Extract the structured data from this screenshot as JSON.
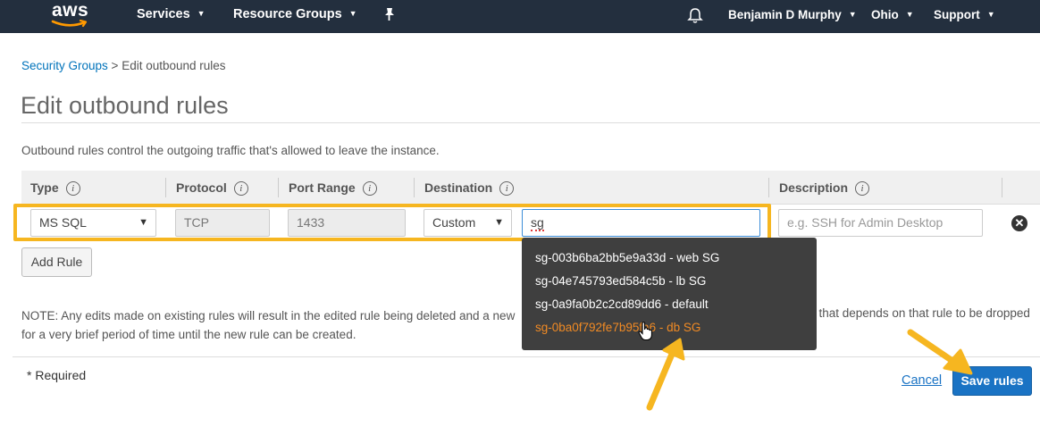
{
  "nav": {
    "logo": "aws",
    "services": "Services",
    "resource_groups": "Resource Groups",
    "pin_icon": "pin-icon",
    "bell_icon": "bell-icon",
    "user": "Benjamin D Murphy",
    "region": "Ohio",
    "support": "Support"
  },
  "breadcrumb": {
    "parent": "Security Groups",
    "separator": " > ",
    "current": "Edit outbound rules"
  },
  "page": {
    "title": "Edit outbound rules",
    "description": "Outbound rules control the outgoing traffic that's allowed to leave the instance."
  },
  "table": {
    "headers": {
      "type": "Type",
      "protocol": "Protocol",
      "port_range": "Port Range",
      "destination": "Destination",
      "description": "Description"
    },
    "row": {
      "type": "MS SQL",
      "protocol": "TCP",
      "port_range": "1433",
      "destination_type": "Custom",
      "destination_value": "sg",
      "description_placeholder": "e.g. SSH for Admin Desktop"
    }
  },
  "dropdown": {
    "items": [
      "sg-003b6ba2bb5e9a33d - web SG",
      "sg-04e745793ed584c5b - lb SG",
      "sg-0a9fa0b2c2cd89dd6 - default",
      "sg-0ba0f792fe7b95fa6 - db SG"
    ],
    "highlighted_index": 3
  },
  "buttons": {
    "add_rule": "Add Rule",
    "cancel": "Cancel",
    "save_rules": "Save rules"
  },
  "note": {
    "line1": "NOTE: Any edits made on existing rules will result in the edited rule being deleted and a new",
    "line1_end": "c that depends on that rule to be dropped",
    "line2": "for a very brief period of time until the new rule can be created."
  },
  "required": "* Required",
  "colors": {
    "nav_bg": "#232f3e",
    "link": "#0073bb",
    "primary": "#1a73c4",
    "highlight_box": "#f6b620",
    "menu_bg": "#3f3f3f",
    "menu_active": "#f08a24"
  }
}
